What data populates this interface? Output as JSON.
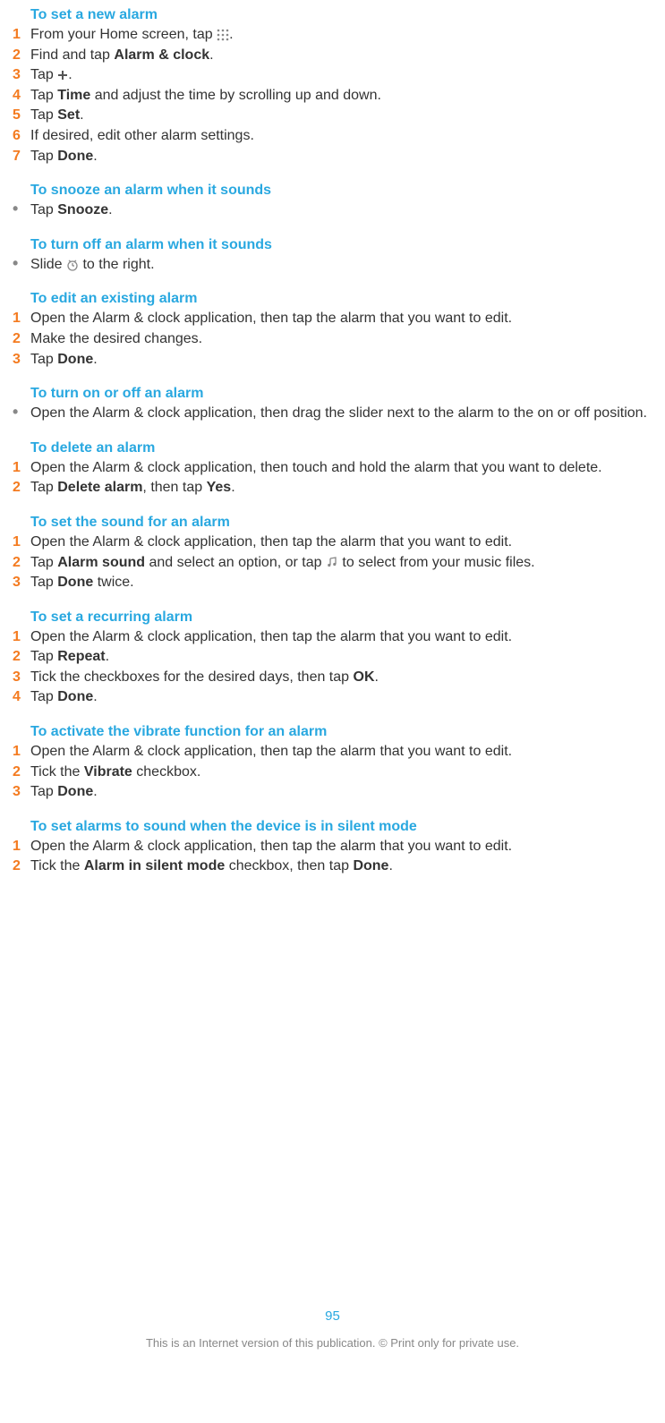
{
  "sections": [
    {
      "title": "To set a new alarm",
      "steps": [
        {
          "n": "1",
          "parts": [
            {
              "t": "From your Home screen, tap "
            },
            {
              "icon": "apps"
            },
            {
              "t": "."
            }
          ]
        },
        {
          "n": "2",
          "parts": [
            {
              "t": "Find and tap "
            },
            {
              "b": "Alarm & clock"
            },
            {
              "t": "."
            }
          ]
        },
        {
          "n": "3",
          "parts": [
            {
              "t": "Tap "
            },
            {
              "icon": "plus"
            },
            {
              "t": "."
            }
          ]
        },
        {
          "n": "4",
          "parts": [
            {
              "t": "Tap "
            },
            {
              "b": "Time"
            },
            {
              "t": " and adjust the time by scrolling up and down."
            }
          ]
        },
        {
          "n": "5",
          "parts": [
            {
              "t": "Tap "
            },
            {
              "b": "Set"
            },
            {
              "t": "."
            }
          ]
        },
        {
          "n": "6",
          "parts": [
            {
              "t": "If desired, edit other alarm settings."
            }
          ]
        },
        {
          "n": "7",
          "parts": [
            {
              "t": "Tap "
            },
            {
              "b": "Done"
            },
            {
              "t": "."
            }
          ]
        }
      ]
    },
    {
      "title": "To snooze an alarm when it sounds",
      "steps": [
        {
          "n": "•",
          "bullet": true,
          "parts": [
            {
              "t": "Tap "
            },
            {
              "b": "Snooze"
            },
            {
              "t": "."
            }
          ]
        }
      ]
    },
    {
      "title": "To turn off an alarm when it sounds",
      "steps": [
        {
          "n": "•",
          "bullet": true,
          "parts": [
            {
              "t": "Slide "
            },
            {
              "icon": "clock"
            },
            {
              "t": " to the right."
            }
          ]
        }
      ]
    },
    {
      "title": "To edit an existing alarm",
      "steps": [
        {
          "n": "1",
          "parts": [
            {
              "t": "Open the Alarm & clock application, then tap the alarm that you want to edit."
            }
          ]
        },
        {
          "n": "2",
          "parts": [
            {
              "t": "Make the desired changes."
            }
          ]
        },
        {
          "n": "3",
          "parts": [
            {
              "t": "Tap "
            },
            {
              "b": "Done"
            },
            {
              "t": "."
            }
          ]
        }
      ]
    },
    {
      "title": "To turn on or off an alarm",
      "steps": [
        {
          "n": "•",
          "bullet": true,
          "parts": [
            {
              "t": "Open the Alarm & clock application, then drag the slider next to the alarm to the on or off position."
            }
          ]
        }
      ]
    },
    {
      "title": "To delete an alarm",
      "steps": [
        {
          "n": "1",
          "parts": [
            {
              "t": "Open the Alarm & clock application, then touch and hold the alarm that you want to delete."
            }
          ]
        },
        {
          "n": "2",
          "parts": [
            {
              "t": "Tap "
            },
            {
              "b": "Delete alarm"
            },
            {
              "t": ", then tap "
            },
            {
              "b": "Yes"
            },
            {
              "t": "."
            }
          ]
        }
      ]
    },
    {
      "title": "To set the sound for an alarm",
      "steps": [
        {
          "n": "1",
          "parts": [
            {
              "t": "Open the Alarm & clock application, then tap the alarm that you want to edit."
            }
          ]
        },
        {
          "n": "2",
          "parts": [
            {
              "t": "Tap "
            },
            {
              "b": "Alarm sound"
            },
            {
              "t": " and select an option, or tap "
            },
            {
              "icon": "music"
            },
            {
              "t": " to select from your music files."
            }
          ]
        },
        {
          "n": "3",
          "parts": [
            {
              "t": "Tap "
            },
            {
              "b": "Done"
            },
            {
              "t": " twice."
            }
          ]
        }
      ]
    },
    {
      "title": "To set a recurring alarm",
      "steps": [
        {
          "n": "1",
          "parts": [
            {
              "t": "Open the Alarm & clock application, then tap the alarm that you want to edit."
            }
          ]
        },
        {
          "n": "2",
          "parts": [
            {
              "t": "Tap "
            },
            {
              "b": "Repeat"
            },
            {
              "t": "."
            }
          ]
        },
        {
          "n": "3",
          "parts": [
            {
              "t": "Tick the checkboxes for the desired days, then tap "
            },
            {
              "b": "OK"
            },
            {
              "t": "."
            }
          ]
        },
        {
          "n": "4",
          "parts": [
            {
              "t": "Tap "
            },
            {
              "b": "Done"
            },
            {
              "t": "."
            }
          ]
        }
      ]
    },
    {
      "title": "To activate the vibrate function for an alarm",
      "steps": [
        {
          "n": "1",
          "parts": [
            {
              "t": "Open the Alarm & clock application, then tap the alarm that you want to edit."
            }
          ]
        },
        {
          "n": "2",
          "parts": [
            {
              "t": "Tick the "
            },
            {
              "b": "Vibrate"
            },
            {
              "t": " checkbox."
            }
          ]
        },
        {
          "n": "3",
          "parts": [
            {
              "t": "Tap "
            },
            {
              "b": "Done"
            },
            {
              "t": "."
            }
          ]
        }
      ]
    },
    {
      "title": "To set alarms to sound when the device is in silent mode",
      "steps": [
        {
          "n": "1",
          "parts": [
            {
              "t": "Open the Alarm & clock application, then tap the alarm that you want to edit."
            }
          ]
        },
        {
          "n": "2",
          "parts": [
            {
              "t": "Tick the "
            },
            {
              "b": "Alarm in silent mode"
            },
            {
              "t": " checkbox, then tap "
            },
            {
              "b": "Done"
            },
            {
              "t": "."
            }
          ]
        }
      ]
    }
  ],
  "page_number": "95",
  "footer_text": "This is an Internet version of this publication. © Print only for private use."
}
